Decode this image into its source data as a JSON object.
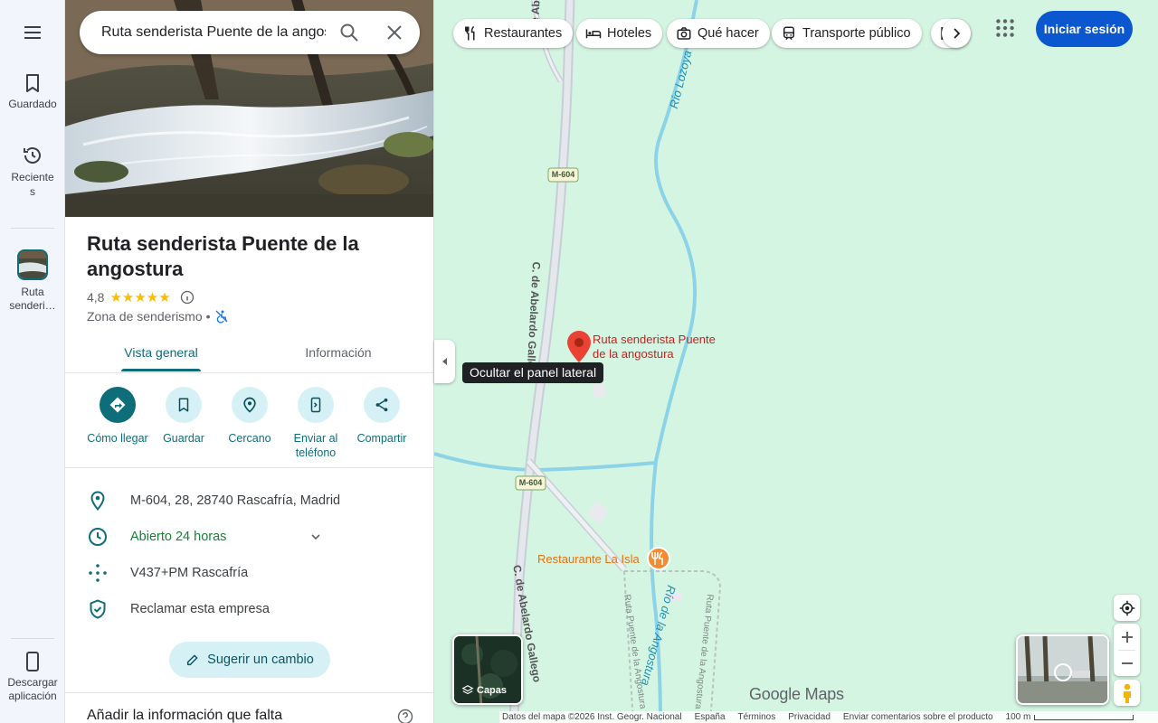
{
  "rail": {
    "menu_icon": "hamburger-menu-icon",
    "saved_label": "Guardado",
    "recent_label_line1": "Reciente",
    "recent_label_line2": "s",
    "place_label_line1": "Ruta",
    "place_label_line2": "senderi…",
    "download_label_line1": "Descargar",
    "download_label_line2": "aplicación"
  },
  "search": {
    "value": "Ruta senderista Puente de la angostura",
    "search_icon": "search-icon",
    "clear_icon": "close-icon"
  },
  "place": {
    "title": "Ruta senderista Puente de la angostura",
    "rating": "4,8",
    "stars": "★★★★★",
    "category": "Zona de senderismo",
    "separator": "•"
  },
  "tabs": [
    {
      "label": "Vista general",
      "active": true
    },
    {
      "label": "Información",
      "active": false
    }
  ],
  "actions": [
    {
      "label": "Cómo llegar",
      "icon": "directions-icon"
    },
    {
      "label": "Guardar",
      "icon": "bookmark-icon"
    },
    {
      "label": "Cercano",
      "icon": "nearby-icon"
    },
    {
      "label_line1": "Enviar al",
      "label_line2": "teléfono",
      "icon": "send-to-phone-icon"
    },
    {
      "label": "Compartir",
      "icon": "share-icon"
    }
  ],
  "info": {
    "address": "M-604, 28, 28740 Rascafría, Madrid",
    "hours": "Abierto 24 horas",
    "plus_code": "V437+PM Rascafría",
    "claim": "Reclamar esta empresa"
  },
  "suggest_label": "Sugerir un cambio",
  "missing_title": "Añadir la información que falta",
  "map": {
    "tooltip": "Ocultar el panel lateral",
    "chips": [
      {
        "label": "Restaurantes",
        "icon": "restaurant-icon"
      },
      {
        "label": "Hoteles",
        "icon": "hotel-icon"
      },
      {
        "label": "Qué hacer",
        "icon": "camera-icon"
      },
      {
        "label": "Transporte público",
        "icon": "transit-icon"
      },
      {
        "label": "",
        "icon": "more-icon"
      }
    ],
    "signin_label": "Iniciar sesión",
    "labels": {
      "pin_line1": "Ruta senderista Puente",
      "pin_line2": "de la angostura",
      "restaurant": "Restaurante La Isla",
      "road_top": "C. de Abelardo Gallego",
      "road_mid": "C. de Abelardo Gallego",
      "road_bottom": "C. de Abelardo Gallego",
      "road_shield_1": "M-604",
      "road_shield_2": "M-604",
      "river_top": "Río Lozoya",
      "river_bottom": "Río de la Angostura",
      "trail_1": "Ruta Puente de la Angostura",
      "trail_2": "Ruta Puente de la Angostura"
    },
    "layers_label": "Capas",
    "logo": "Google Maps",
    "footer": {
      "data": "Datos del mapa ©2026 Inst. Geogr. Nacional",
      "country": "España",
      "terms": "Términos",
      "privacy": "Privacidad",
      "feedback": "Enviar comentarios sobre el producto",
      "scale": "100 m"
    },
    "colors": {
      "background": "#d5f5e3",
      "road": "#c9ced6",
      "river": "#8dd3e8",
      "pin": "#ea4335",
      "accent": "#0d6e7a",
      "signin": "#0b57d0"
    }
  }
}
